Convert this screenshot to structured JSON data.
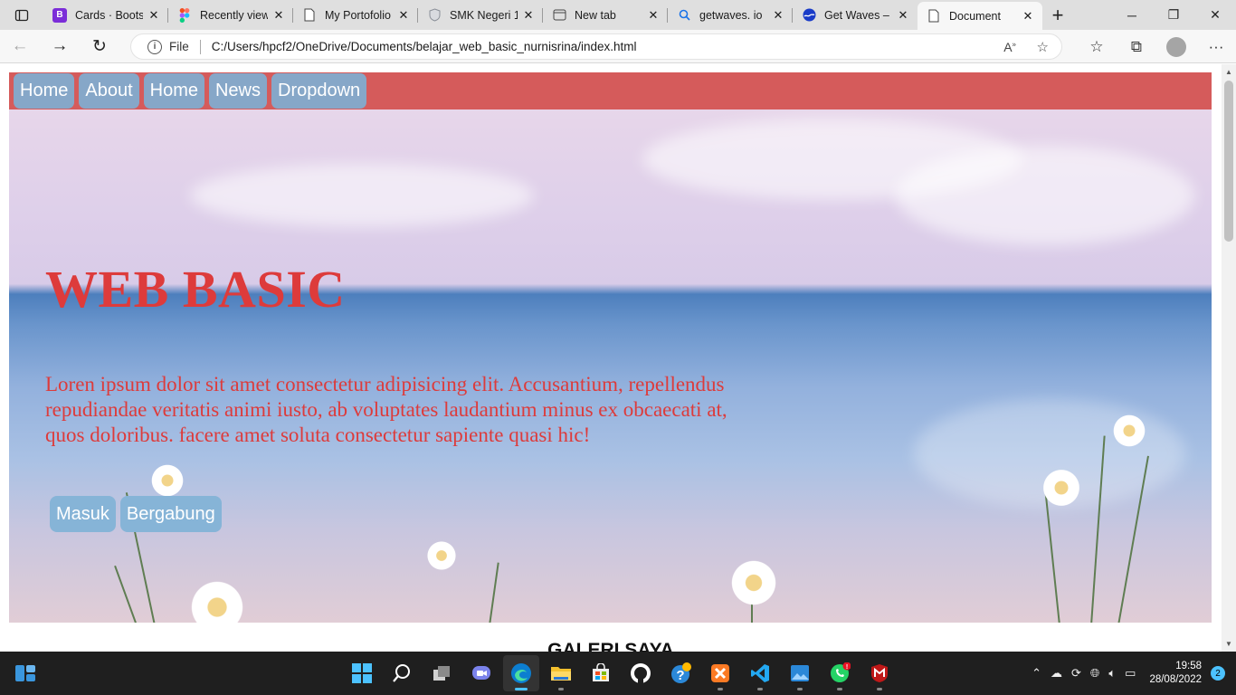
{
  "browser": {
    "tabs": [
      {
        "title": "Cards · Bootst",
        "icon": "bootstrap-icon",
        "icon_text": "B",
        "icon_color": "#7b2dd8"
      },
      {
        "title": "Recently view",
        "icon": "figma-icon",
        "icon_text": "",
        "icon_color": "#f24e1e"
      },
      {
        "title": "My Portofolio",
        "icon": "page-icon",
        "icon_text": "",
        "icon_color": "#ffffff"
      },
      {
        "title": "SMK Negeri 1",
        "icon": "shield-icon",
        "icon_text": "",
        "icon_color": "#9aa0a6"
      },
      {
        "title": "New tab",
        "icon": "newtab-icon",
        "icon_text": "",
        "icon_color": "#555555"
      },
      {
        "title": "getwaves. io",
        "icon": "search-icon",
        "icon_text": "",
        "icon_color": "#1a73e8"
      },
      {
        "title": "Get Waves – C",
        "icon": "waves-icon",
        "icon_text": "",
        "icon_color": "#1a3cc8"
      },
      {
        "title": "Document",
        "icon": "page-icon",
        "icon_text": "",
        "icon_color": "#ffffff",
        "active": true
      }
    ],
    "address": {
      "label": "File",
      "url": "C:/Users/hpcf2/OneDrive/Documents/belajar_web_basic_nurnisrina/index.html"
    }
  },
  "page": {
    "nav": [
      "Home",
      "About",
      "Home",
      "News",
      "Dropdown"
    ],
    "hero": {
      "title": "WEB BASIC",
      "text": "Loren ipsum dolor sit amet consectetur adipisicing elit. Accusantium, repellendus repudiandae veritatis animi iusto, ab voluptates laudantium minus ex obcaecati at, quos doloribus. facere amet soluta consectetur sapiente quasi hic!",
      "buttons": [
        "Masuk",
        "Bergabung"
      ]
    },
    "gallery_title": "GALERI SAYA"
  },
  "taskbar": {
    "time": "19:58",
    "date": "28/08/2022",
    "notifications": "2",
    "apps": [
      "windows-icon",
      "search-icon",
      "task-view-icon",
      "teams-chat-icon",
      "edge-icon",
      "file-explorer-icon",
      "store-icon",
      "github-icon",
      "tips-icon",
      "xampp-icon",
      "vscode-icon",
      "photos-icon",
      "whatsapp-icon",
      "mcafee-icon"
    ]
  },
  "colors": {
    "nav_bg": "#d55b5b",
    "nav_button": "#86a7c8",
    "hero_text": "#dd3b3b",
    "hero_button": "#86b4d7"
  }
}
